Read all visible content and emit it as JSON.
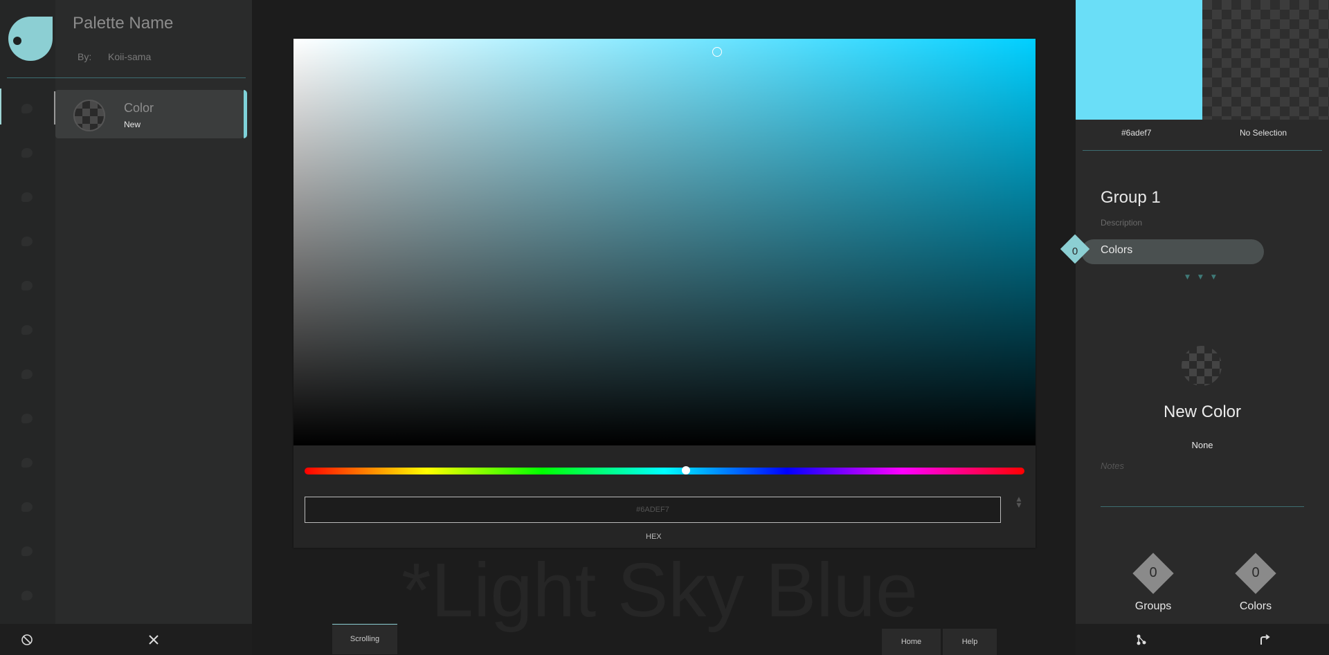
{
  "palette": {
    "name": "Palette Name",
    "by_label": "By:",
    "author": "Koii-sama"
  },
  "color_item": {
    "label": "Color",
    "sub": "New"
  },
  "picker": {
    "background_name": "*Light Sky Blue",
    "hex_value": "#6ADEF7",
    "hex_label": "HEX",
    "hue_fraction": 0.53
  },
  "bottom": {
    "scrolling": "Scrolling",
    "home": "Home",
    "help": "Help"
  },
  "right": {
    "current_hex": "#6adef7",
    "selection": "No Selection",
    "group_title": "Group 1",
    "group_desc": "Description",
    "colors_tab": "Colors",
    "colors_count": "0",
    "new_color_title": "New Color",
    "new_color_sub": "None",
    "notes_placeholder": "Notes",
    "stats": [
      {
        "value": "0",
        "label": "Groups"
      },
      {
        "value": "0",
        "label": "Colors"
      }
    ]
  },
  "colors": {
    "accent": "#8ccfd3",
    "current": "#6adef7",
    "panel": "#2a2a2a"
  },
  "icons": {
    "clear": "prohibited-icon",
    "close": "close-icon",
    "share": "share-icon",
    "export": "export-icon"
  }
}
